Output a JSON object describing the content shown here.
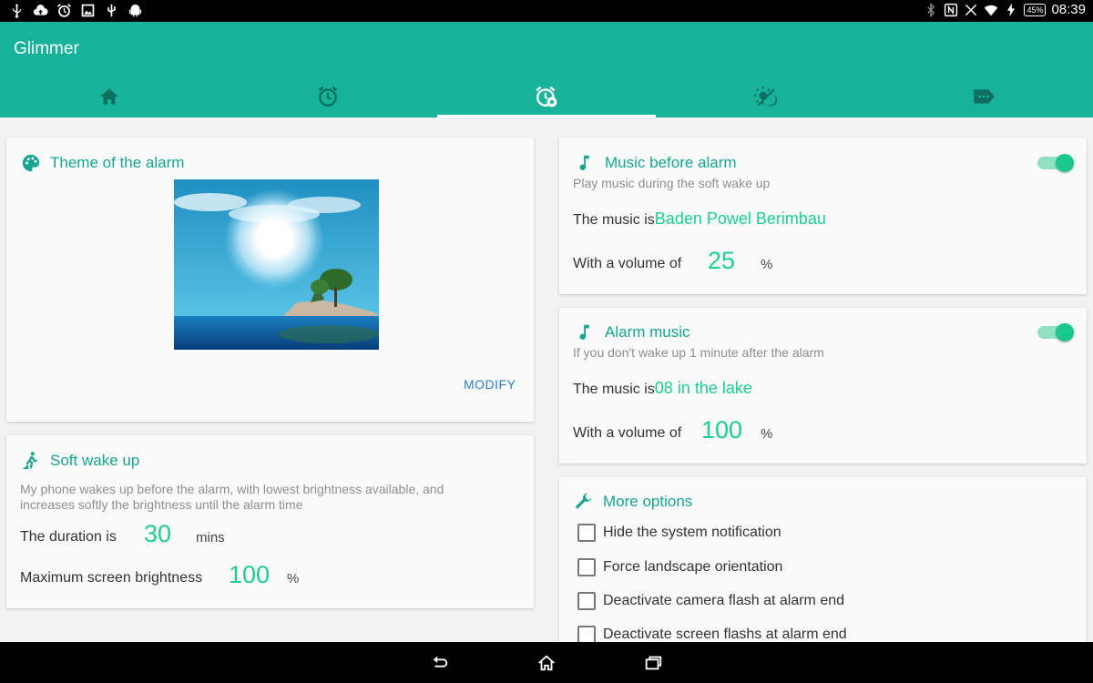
{
  "app": {
    "title": "Glimmer"
  },
  "status": {
    "battery": "45%",
    "time": "08:39"
  },
  "tabs": [
    {
      "icon": "home-icon"
    },
    {
      "icon": "alarm-clock-icon"
    },
    {
      "icon": "alarm-settings-icon",
      "active": true
    },
    {
      "icon": "weather-icon"
    },
    {
      "icon": "label-icon"
    }
  ],
  "theme": {
    "title": "Theme of the alarm",
    "modify": "MODIFY"
  },
  "soft": {
    "title": "Soft wake up",
    "desc": "My phone wakes up before the alarm, with lowest brightness available, and increases softly the brightness until the alarm time",
    "duration_label": "The duration is",
    "duration": "30",
    "duration_unit": "mins",
    "brightness_label": "Maximum screen brightness",
    "brightness": "100",
    "brightness_unit": "%"
  },
  "music_before": {
    "title": "Music before alarm",
    "sub": "Play music during the soft wake up",
    "music_label": "The music is",
    "music": "Baden Powel  Berimbau",
    "volume_label": "With a volume of",
    "volume": "25",
    "volume_unit": "%",
    "enabled": true
  },
  "alarm_music": {
    "title": "Alarm music",
    "sub": "If you don't wake up 1 minute after the alarm",
    "music_label": "The music is",
    "music": "08  in the lake",
    "volume_label": "With a volume of",
    "volume": "100",
    "volume_unit": "%",
    "enabled": true
  },
  "more": {
    "title": "More options",
    "options": [
      "Hide the system notification",
      "Force landscape orientation",
      "Deactivate camera flash at alarm end",
      "Deactivate screen flashs at alarm end"
    ]
  },
  "colors": {
    "primary": "#16b39a",
    "accent": "#1dcf8f",
    "link": "#2a7fc9"
  }
}
